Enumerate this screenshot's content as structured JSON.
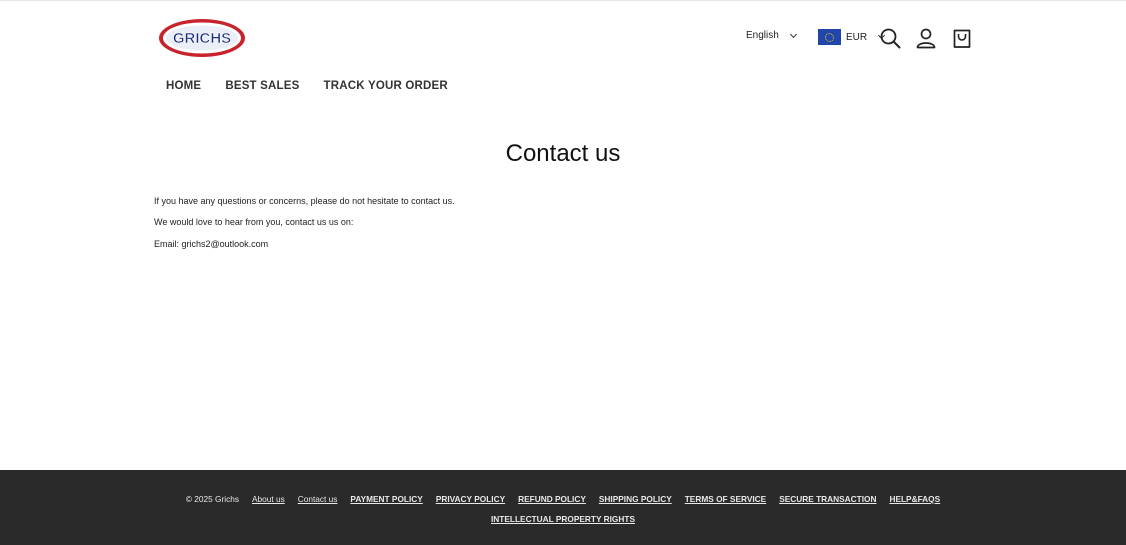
{
  "header": {
    "logo_text": "GRICHS",
    "language": "English",
    "currency": "EUR",
    "colors": {
      "logo_red": "#c8232c",
      "logo_blue": "#1b2f7a",
      "flag_blue": "#1f46a8",
      "flag_star": "#f5d328"
    }
  },
  "icons": {
    "search": "search-icon",
    "account": "user-icon",
    "cart": "cart-icon",
    "flag": "eu-flag-icon"
  },
  "nav": {
    "items": [
      {
        "label": "HOME"
      },
      {
        "label": "BEST SALES"
      },
      {
        "label": "TRACK YOUR ORDER"
      }
    ]
  },
  "main": {
    "title": "Contact us",
    "paragraphs": [
      "If you have any questions or concerns, please do not hesitate to contact us.",
      "We would love to hear from you, contact us us on:",
      "Email: grichs2@outlook.com"
    ]
  },
  "footer": {
    "background": "#2a2a2a",
    "copyright": "© 2025 Grichs",
    "links": [
      {
        "label": "About us"
      },
      {
        "label": "Contact us"
      },
      {
        "label": "PAYMENT POLICY"
      },
      {
        "label": "PRIVACY POLICY"
      },
      {
        "label": "REFUND POLICY"
      },
      {
        "label": "SHIPPING POLICY"
      },
      {
        "label": "TERMS OF SERVICE"
      },
      {
        "label": "SECURE TRANSACTION"
      },
      {
        "label": "HELP&FAQS"
      }
    ],
    "links_row2": [
      {
        "label": "INTELLECTUAL PROPERTY RIGHTS"
      }
    ]
  }
}
